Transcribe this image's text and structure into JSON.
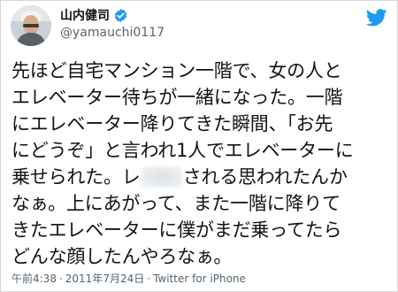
{
  "tweet": {
    "display_name": "山内健司",
    "handle": "@yamauchi0117",
    "verified_icon": "verified-badge-icon",
    "brand_icon": "twitter-bird-icon",
    "accent_color": "#1d9bf0",
    "body": {
      "line1": "先ほど自宅マンション一階で、女の人と",
      "line2": "エレベーター待ちが一緒になった。一階",
      "line3": "にエレベーター降りてきた瞬間、「お先",
      "line4": "にどうぞ」と言われ1人でエレベーターに",
      "line5_before": "乗せられた。レ",
      "line5_after": "される思われたんか",
      "line6": "なぁ。上にあがって、また一階に降りて",
      "line7": "きたエレベーターに僕がまだ乗ってたら",
      "line8": "どんな顔したんやろなぁ。"
    },
    "time": "午前4:38",
    "date": "2011年7月24日",
    "separator": "·",
    "source": "Twitter for iPhone"
  }
}
